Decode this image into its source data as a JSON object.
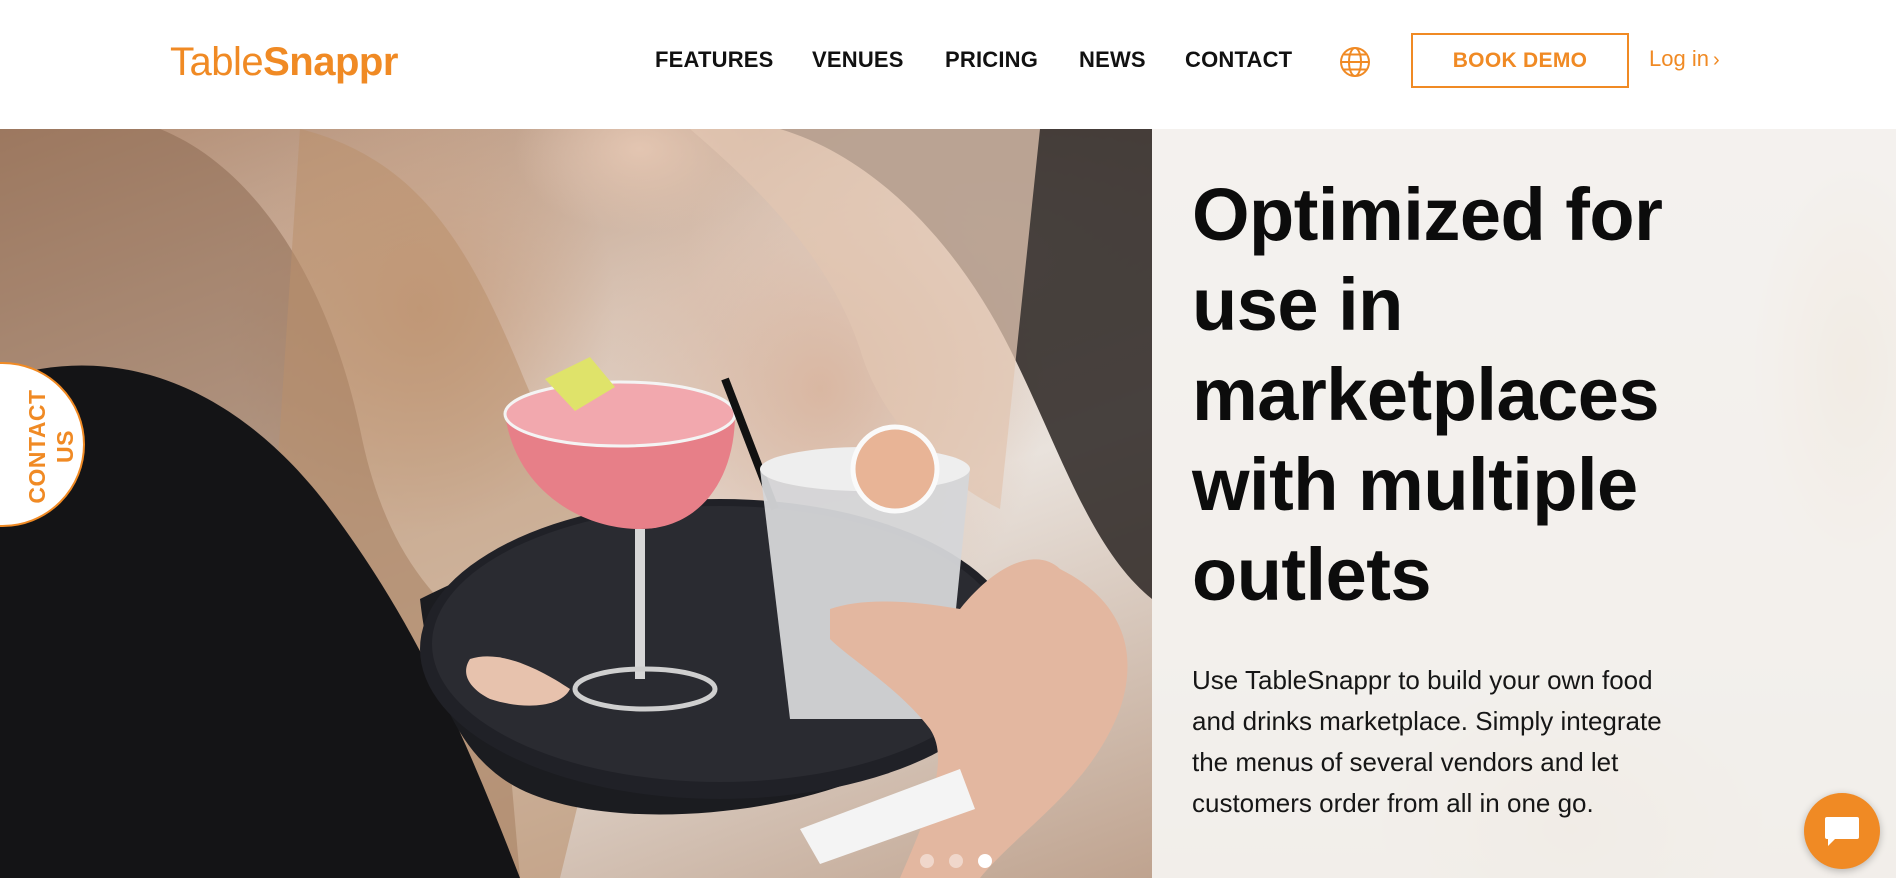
{
  "brand": {
    "name_light": "Table",
    "name_bold": "Snappr",
    "accent_color": "#f08a24"
  },
  "nav": {
    "links": [
      {
        "label": "FEATURES"
      },
      {
        "label": "VENUES"
      },
      {
        "label": "PRICING"
      },
      {
        "label": "NEWS"
      },
      {
        "label": "CONTACT"
      }
    ],
    "language_icon": "globe-icon",
    "book_demo_label": "BOOK DEMO",
    "login_label": "Log in",
    "login_chevron": "›"
  },
  "hero": {
    "headline_lines": [
      "Optimized for",
      "use in",
      "marketplaces",
      "with multiple",
      "outlets"
    ],
    "description_lines": [
      "Use TableSnappr to build your own food",
      "and drinks marketplace. Simply integrate",
      "the menus of several vendors and let",
      "customers order from all in one go."
    ],
    "image_subject": "server carrying a tray with a pink cocktail and a lime soda",
    "carousel": {
      "total": 3,
      "active_index": 2
    }
  },
  "contact_tab": {
    "line1": "CONTACT",
    "line2": "US"
  },
  "chat_widget": {
    "icon": "chat-bubble-icon"
  }
}
